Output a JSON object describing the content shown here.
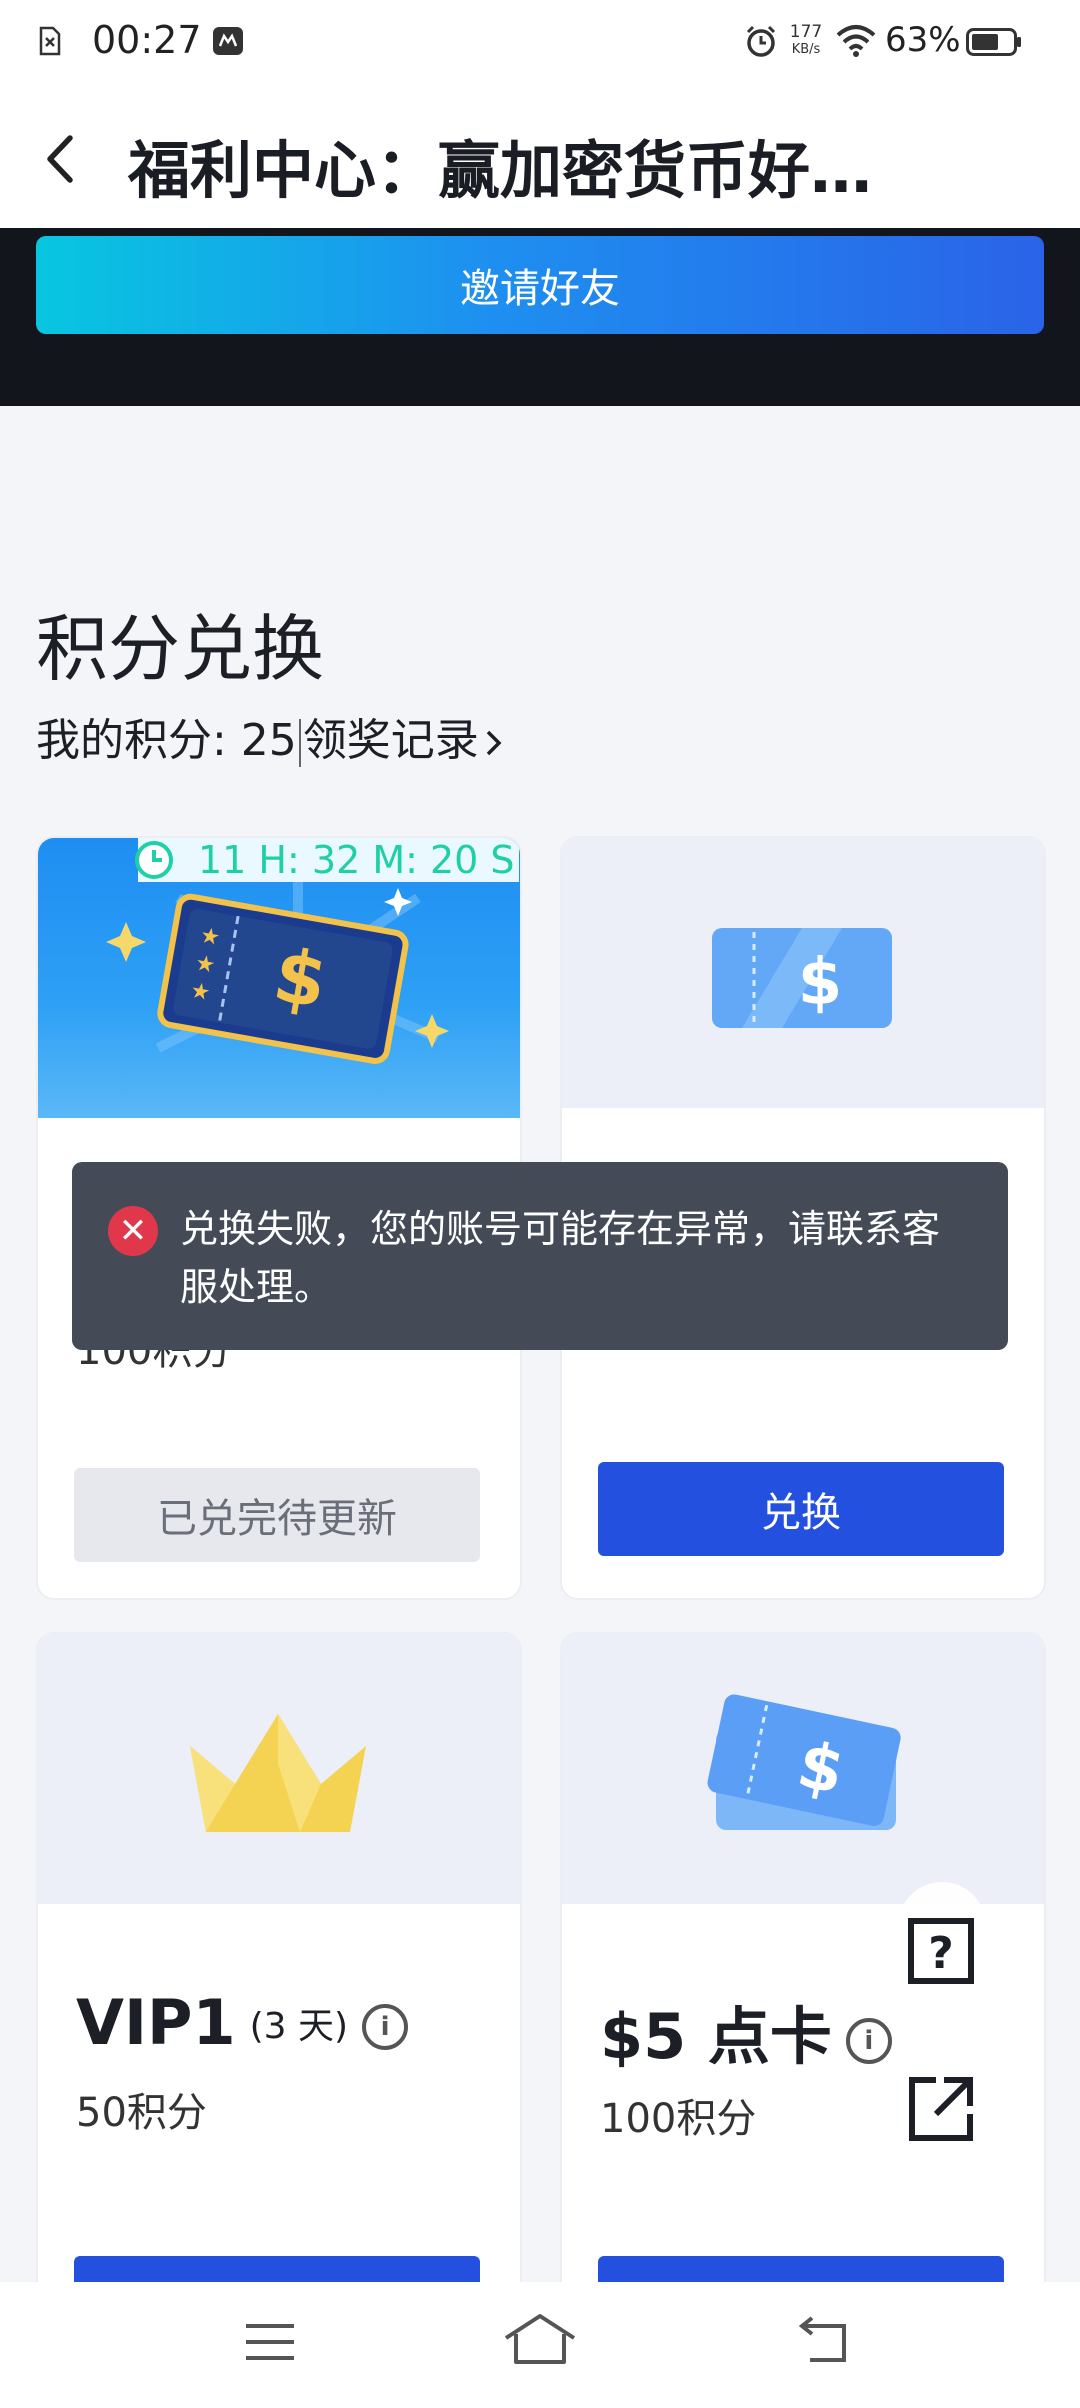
{
  "status_bar": {
    "time": "00:27",
    "net_speed_value": "177",
    "net_speed_unit": "KB/s",
    "battery": "63%"
  },
  "header": {
    "title": "福利中心：赢加密货币好…"
  },
  "invite_button": "邀请好友",
  "exchange": {
    "section_title": "积分兑换",
    "my_points_label": "我的积分: 25",
    "records_link": "领奖记录"
  },
  "cards": [
    {
      "countdown": "11 H: 32 M: 20 S",
      "points": "100积分",
      "button": "已兑完待更新"
    },
    {
      "button": "兑换"
    },
    {
      "name": "VIP1",
      "duration": "(3 天)",
      "points": "50积分"
    },
    {
      "name": "$5 点卡",
      "points": "100积分"
    }
  ],
  "toast": {
    "message": "兑换失败，您的账号可能存在异常，请联系客服处理。"
  },
  "icons": {
    "back": "chevron-left-icon",
    "alarm": "alarm-icon",
    "wifi": "wifi-icon",
    "battery": "battery-icon",
    "help": "help-icon",
    "share": "share-icon",
    "menu": "menu-icon",
    "home": "home-icon",
    "return": "back-arrow-icon"
  },
  "colors": {
    "primary": "#2450e0",
    "toast_bg": "#444b57",
    "error": "#e0384a",
    "countdown": "#1ecfa8"
  }
}
